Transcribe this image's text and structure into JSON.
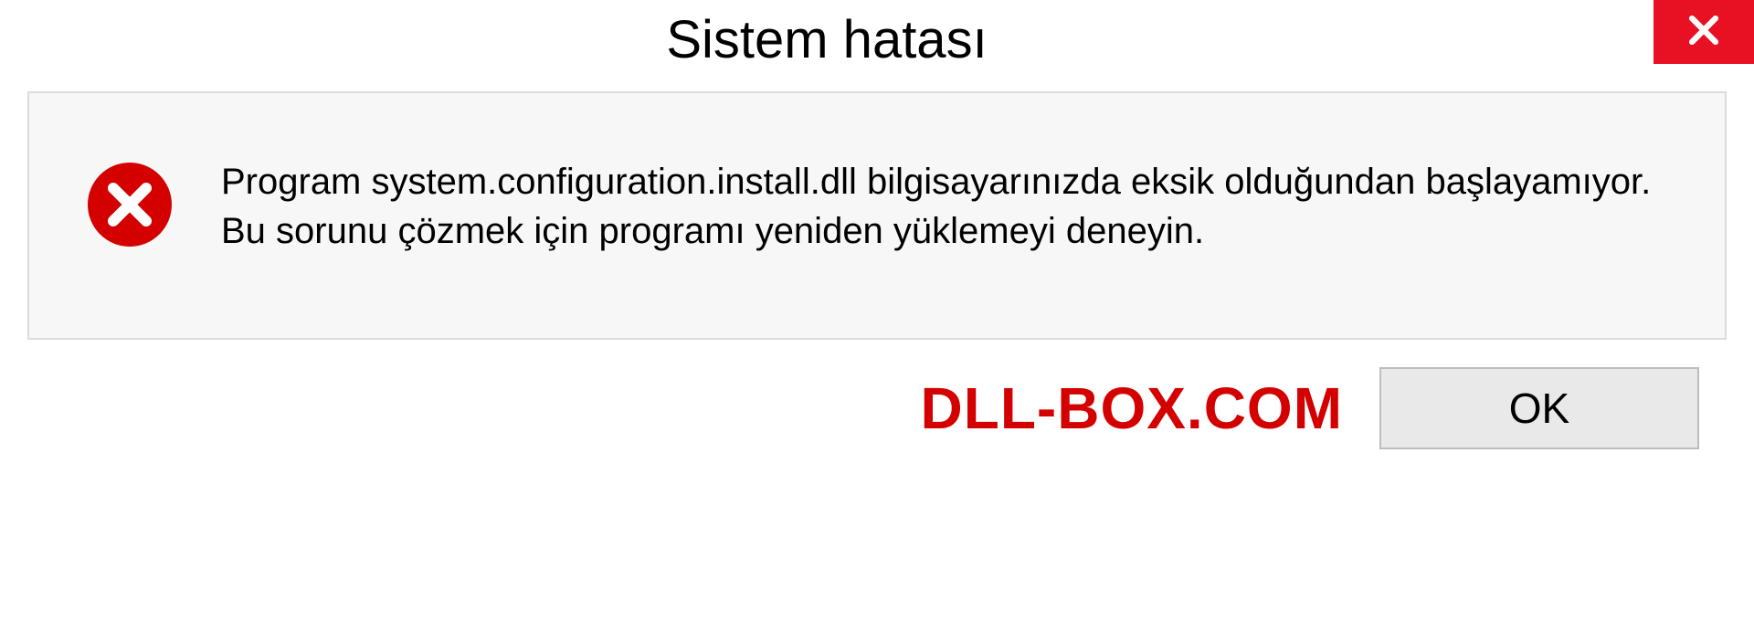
{
  "dialog": {
    "title": "Sistem hatası",
    "message": "Program system.configuration.install.dll bilgisayarınızda eksik olduğundan başlayamıyor. Bu sorunu çözmek için programı yeniden yüklemeyi deneyin.",
    "ok_label": "OK"
  },
  "watermark": "DLL-BOX.COM"
}
